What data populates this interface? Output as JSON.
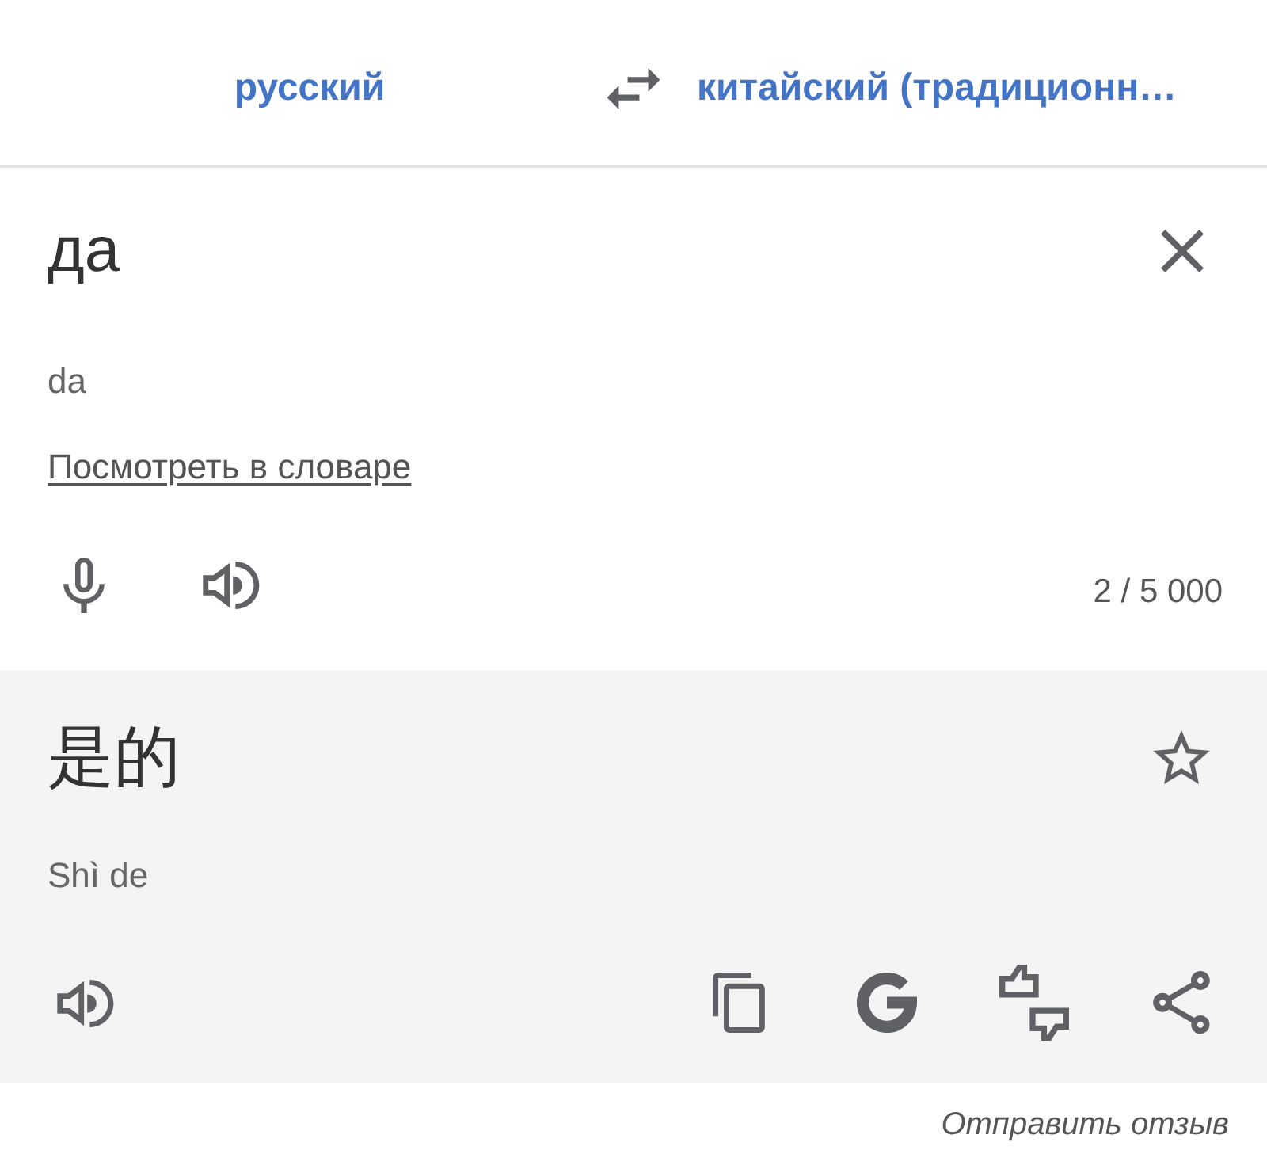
{
  "language_bar": {
    "source_language": "русский",
    "target_language": "китайский (традиционн…"
  },
  "source": {
    "text": "да",
    "transliteration": "da",
    "dictionary_link": "Посмотреть в словаре",
    "character_count": "2 / 5 000"
  },
  "translation": {
    "text": "是的",
    "transliteration": "Shì de",
    "saved": false
  },
  "feedback_link": "Отправить отзыв"
}
